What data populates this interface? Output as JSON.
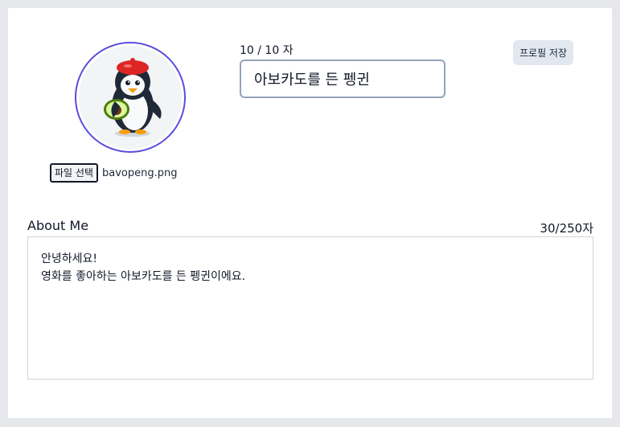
{
  "profile": {
    "avatar_alt": "penguin-holding-avocado",
    "file_button_label": "파일 선택",
    "file_name": "bavopeng.png",
    "name_counter": "10 / 10 자",
    "name_value": "아보카도를 든 펭귄",
    "save_label": "프로필 저장"
  },
  "about": {
    "label": "About Me",
    "counter": "30/250자",
    "text": "안녕하세요!\n영화를 좋아하는 아보카도를 든 펭귄이에요."
  },
  "colors": {
    "avatar_ring": "#5b4ddb",
    "input_border": "#94a3b8",
    "save_button_bg": "#e2e8f0"
  }
}
